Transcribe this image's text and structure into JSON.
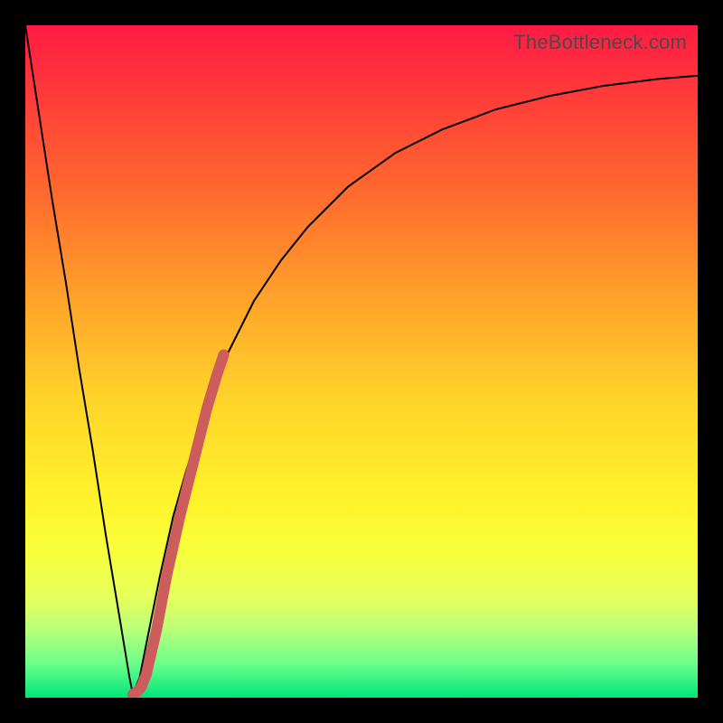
{
  "watermark": "TheBottleneck.com",
  "chart_data": {
    "type": "line",
    "title": "",
    "xlabel": "",
    "ylabel": "",
    "xlim": [
      0,
      100
    ],
    "ylim": [
      0,
      100
    ],
    "grid": false,
    "legend": false,
    "series": [
      {
        "name": "bottleneck-curve",
        "color": "#000000",
        "stroke_width": 2,
        "x": [
          0,
          2,
          4,
          6,
          8,
          10,
          12,
          14,
          15.5,
          16,
          17,
          18,
          20,
          22,
          24,
          26,
          28,
          30,
          34,
          38,
          42,
          48,
          55,
          62,
          70,
          78,
          86,
          94,
          100
        ],
        "y": [
          100,
          87,
          74,
          62,
          49,
          37,
          24,
          12,
          3,
          0.5,
          3,
          8,
          18,
          27,
          34,
          40,
          46,
          51,
          59,
          65,
          70,
          76,
          81,
          84.5,
          87.5,
          89.5,
          91,
          92,
          92.5
        ]
      },
      {
        "name": "highlight-segment",
        "color": "#cd5c5c",
        "stroke_width": 12,
        "x": [
          16,
          16.5,
          17.2,
          18.0,
          19.5,
          21.0,
          23.0,
          25.0,
          27.0,
          28.5,
          29.5
        ],
        "y": [
          0.5,
          0.8,
          1.5,
          3.5,
          10,
          18,
          27,
          35,
          43,
          48,
          51
        ]
      }
    ],
    "background_gradient": {
      "type": "vertical",
      "stops": [
        {
          "pos": 0.0,
          "color": "#ff1a44"
        },
        {
          "pos": 0.25,
          "color": "#ff6a2e"
        },
        {
          "pos": 0.55,
          "color": "#ffd22a"
        },
        {
          "pos": 0.78,
          "color": "#f8ff3a"
        },
        {
          "pos": 0.95,
          "color": "#6aff8a"
        },
        {
          "pos": 1.0,
          "color": "#00e57a"
        }
      ]
    }
  },
  "colors": {
    "frame": "#000000",
    "curve": "#000000",
    "highlight": "#cd5c5c"
  }
}
